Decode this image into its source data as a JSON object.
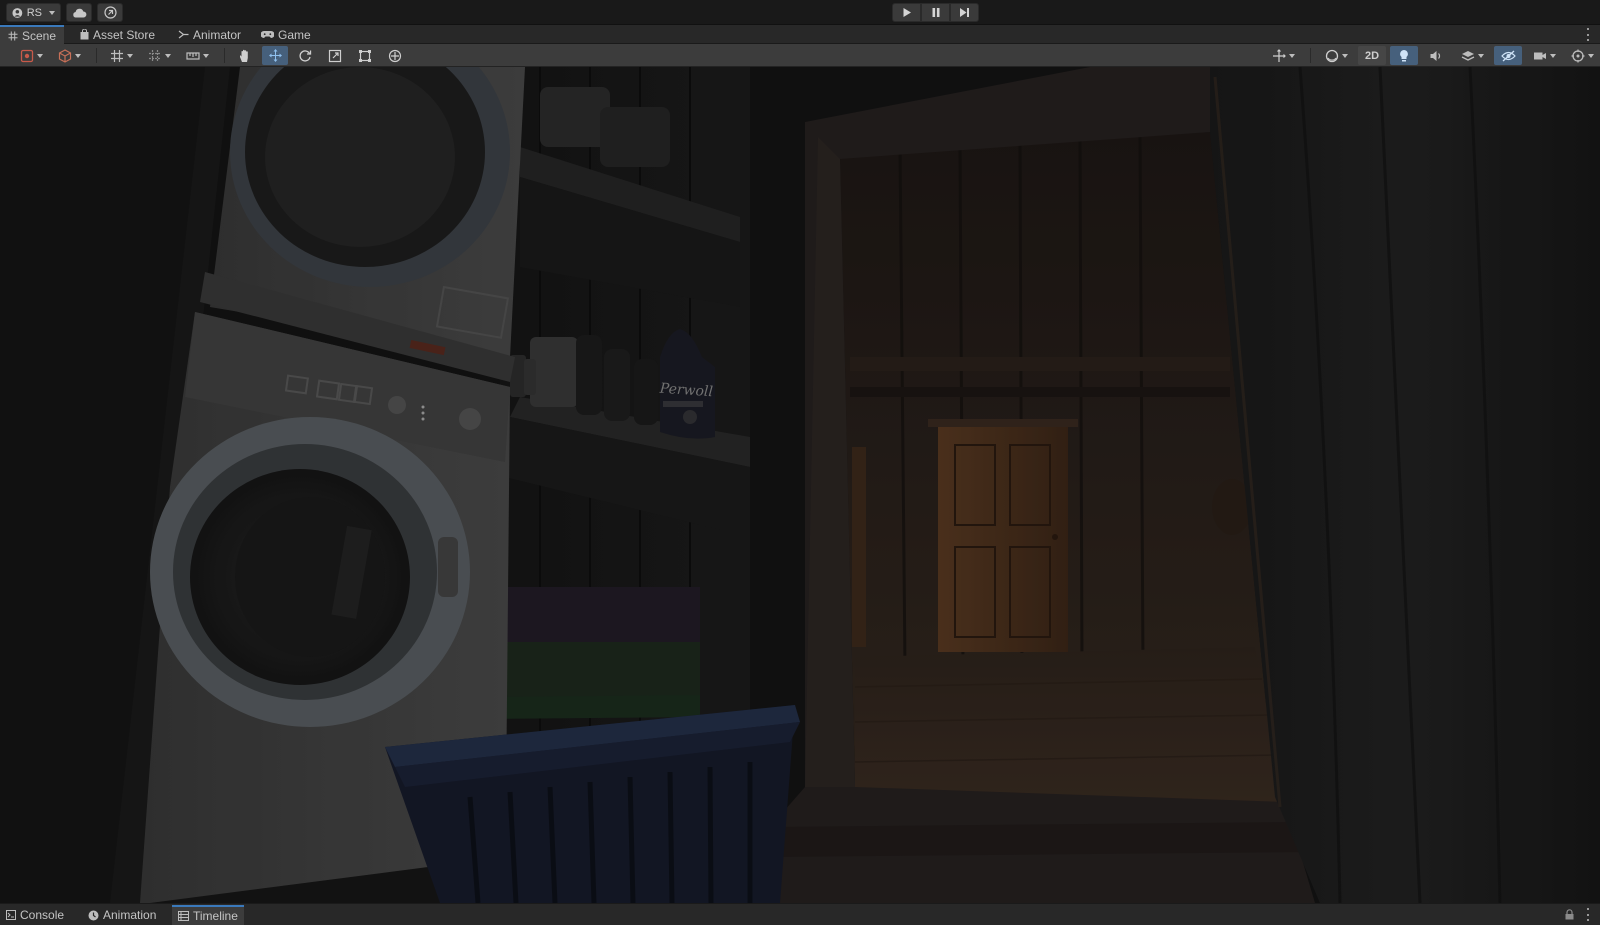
{
  "account": {
    "initials": "RS"
  },
  "tabs": [
    {
      "label": "Scene"
    },
    {
      "label": "Asset Store"
    },
    {
      "label": "Animator"
    },
    {
      "label": "Game"
    }
  ],
  "scene_toolbar": {
    "mode_2d_label": "2D"
  },
  "scene_3d": {
    "bottle_label": "Perwoll"
  },
  "bottom_tabs": [
    {
      "label": "Console"
    },
    {
      "label": "Animation"
    },
    {
      "label": "Timeline"
    }
  ],
  "colors": {
    "accent": "#3a79bb",
    "panel": "#3c3c3c",
    "background": "#191919"
  }
}
